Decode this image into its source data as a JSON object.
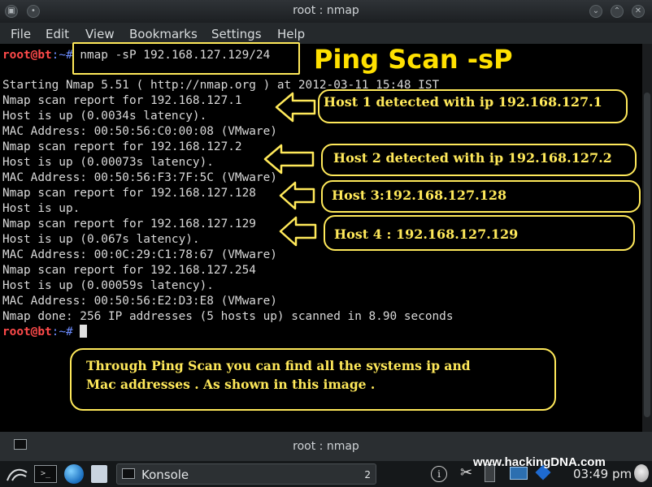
{
  "window": {
    "title": "root : nmap"
  },
  "menu": [
    "File",
    "Edit",
    "View",
    "Bookmarks",
    "Settings",
    "Help"
  ],
  "terminal": {
    "prompt_user": "root@bt",
    "prompt_path": ":~#",
    "command": " nmap -sP 192.168.127.129/24",
    "lines": [
      "Starting Nmap 5.51 ( http://nmap.org ) at 2012-03-11 15:48 IST",
      "Nmap scan report for 192.168.127.1",
      "Host is up (0.0034s latency).",
      "MAC Address: 00:50:56:C0:00:08 (VMware)",
      "Nmap scan report for 192.168.127.2",
      "Host is up (0.00073s latency).",
      "MAC Address: 00:50:56:F3:7F:5C (VMware)",
      "Nmap scan report for 192.168.127.128",
      "Host is up.",
      "Nmap scan report for 192.168.127.129",
      "Host is up (0.067s latency).",
      "MAC Address: 00:0C:29:C1:78:67 (VMware)",
      "Nmap scan report for 192.168.127.254",
      "Host is up (0.00059s latency).",
      "MAC Address: 00:50:56:E2:D3:E8 (VMware)",
      "Nmap done: 256 IP addresses (5 hosts up) scanned in 8.90 seconds"
    ]
  },
  "annotations": {
    "heading": "Ping Scan  -sP",
    "host1": "Host 1 detected with ip 192.168.127.1",
    "host2": "Host 2 detected with ip 192.168.127.2",
    "host3": "Host 3:192.168.127.128",
    "host4": "Host 4 : 192.168.127.129",
    "note_line1": "Through Ping Scan you can find all the systems  ip and",
    "note_line2": "Mac addresses . As shown in this image ."
  },
  "tab": {
    "title": "root : nmap"
  },
  "taskbar": {
    "task_label": "Konsole",
    "task_count": "2",
    "clock": "03:49 pm"
  },
  "watermark": "www.hackingDNA.com",
  "colors": {
    "annotation": "#ffe95a",
    "prompt_user": "#ff4a4a",
    "prompt_path": "#6c8cff"
  }
}
